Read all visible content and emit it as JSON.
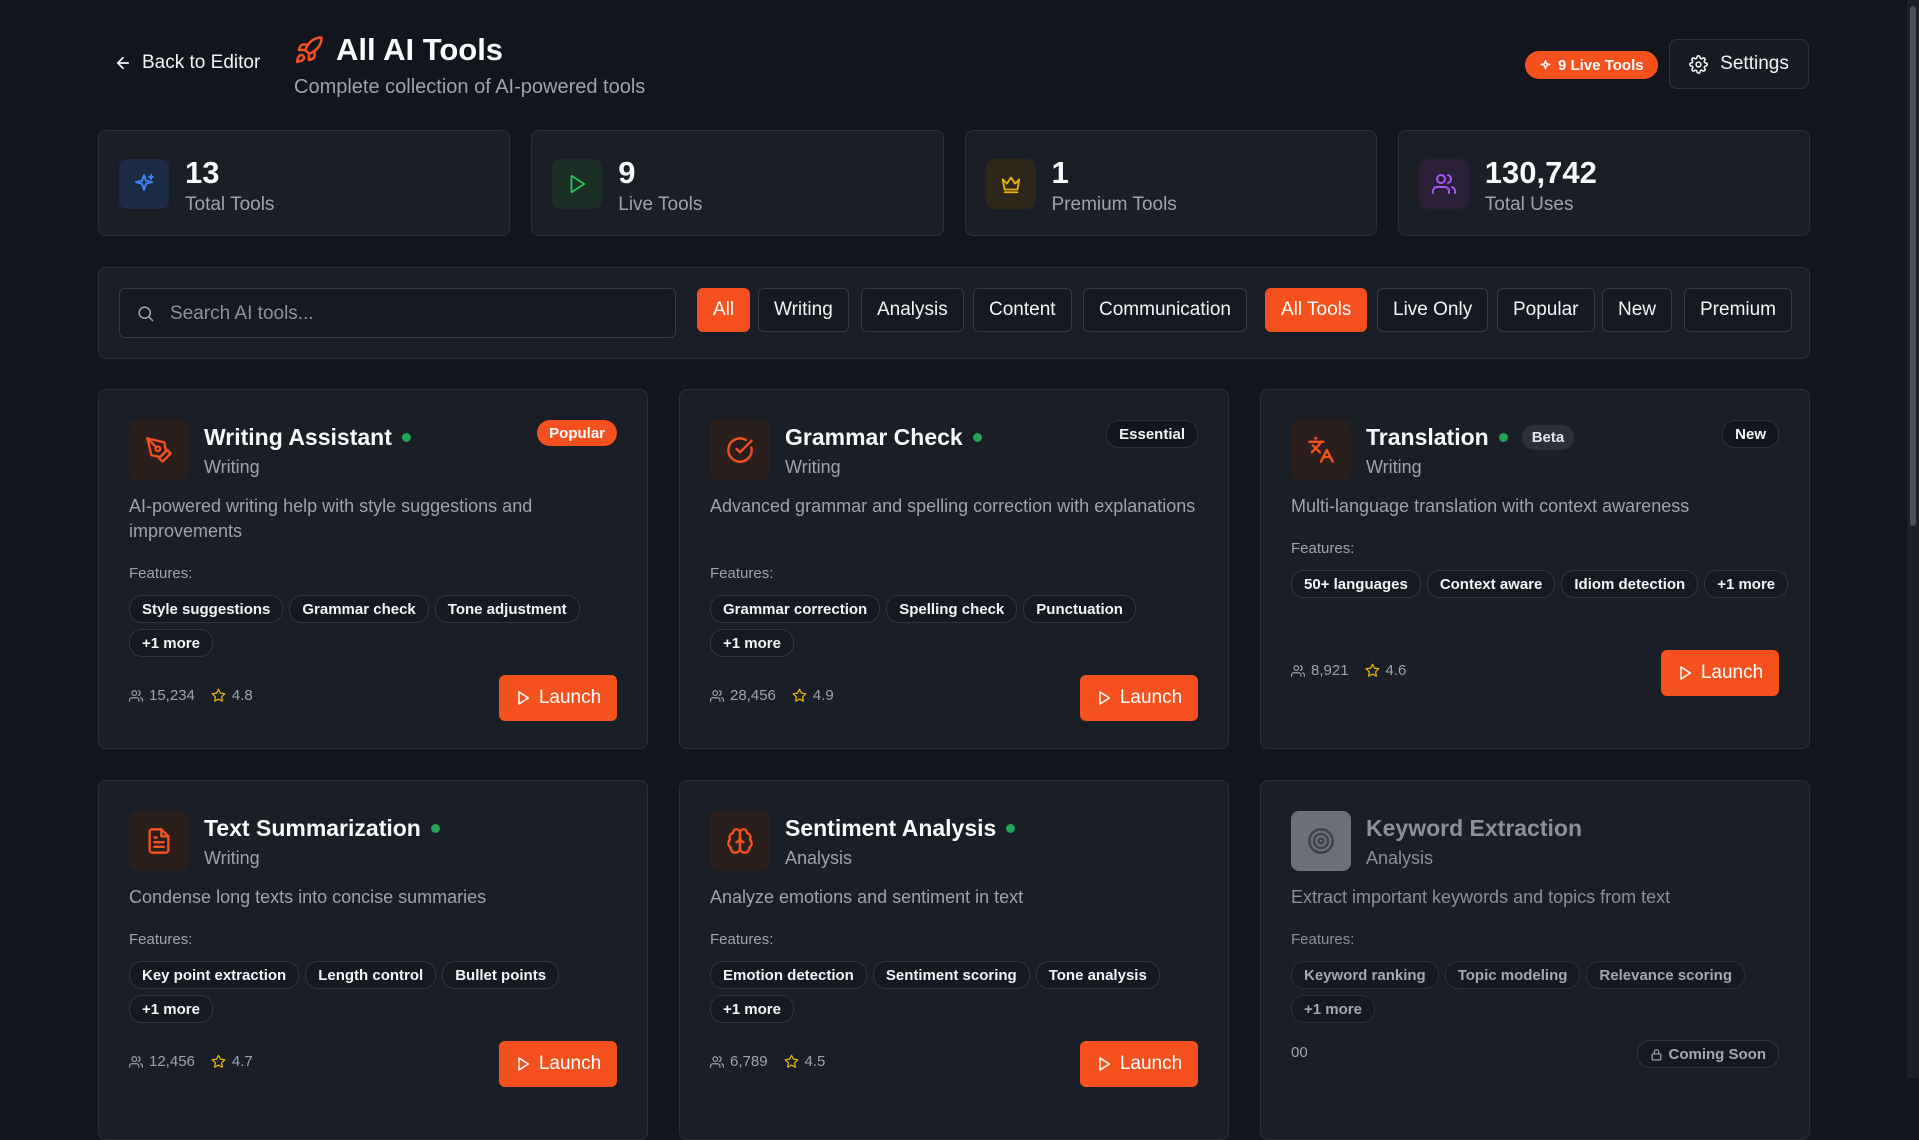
{
  "header": {
    "back_label": "Back to Editor",
    "title": "All AI Tools",
    "subtitle": "Complete collection of AI-powered tools",
    "live_badge": "9 Live Tools",
    "settings_label": "Settings"
  },
  "stats": [
    {
      "value": "13",
      "label": "Total Tools",
      "icon": "sparkles-icon"
    },
    {
      "value": "9",
      "label": "Live Tools",
      "icon": "play-icon"
    },
    {
      "value": "1",
      "label": "Premium Tools",
      "icon": "crown-icon"
    },
    {
      "value": "130,742",
      "label": "Total Uses",
      "icon": "users-icon"
    }
  ],
  "search": {
    "placeholder": "Search AI tools..."
  },
  "category_filters": [
    "All",
    "Writing",
    "Analysis",
    "Content",
    "Communication"
  ],
  "status_filters": [
    "All Tools",
    "Live Only",
    "Popular",
    "New",
    "Premium"
  ],
  "features_label": "Features:",
  "launch_label": "Launch",
  "tools": [
    {
      "name": "Writing Assistant",
      "category": "Writing",
      "badge": "Popular",
      "description": "AI-powered writing help with style suggestions and improvements",
      "features": [
        "Style suggestions",
        "Grammar check",
        "Tone adjustment",
        "+1 more"
      ],
      "users": "15,234",
      "rating": "4.8"
    },
    {
      "name": "Grammar Check",
      "category": "Writing",
      "badge": "Essential",
      "description": "Advanced grammar and spelling correction with explanations",
      "features": [
        "Grammar correction",
        "Spelling check",
        "Punctuation",
        "+1 more"
      ],
      "users": "28,456",
      "rating": "4.9"
    },
    {
      "name": "Translation",
      "category": "Writing",
      "tag": "Beta",
      "badge": "New",
      "description": "Multi-language translation with context awareness",
      "features": [
        "50+ languages",
        "Context aware",
        "Idiom detection",
        "+1 more"
      ],
      "users": "8,921",
      "rating": "4.6"
    },
    {
      "name": "Text Summarization",
      "category": "Writing",
      "description": "Condense long texts into concise summaries",
      "features": [
        "Key point extraction",
        "Length control",
        "Bullet points",
        "+1 more"
      ],
      "users": "12,456",
      "rating": "4.7"
    },
    {
      "name": "Sentiment Analysis",
      "category": "Analysis",
      "description": "Analyze emotions and sentiment in text",
      "features": [
        "Emotion detection",
        "Sentiment scoring",
        "Tone analysis",
        "+1 more"
      ],
      "users": "6,789",
      "rating": "4.5"
    },
    {
      "name": "Keyword Extraction",
      "category": "Analysis",
      "description": "Extract important keywords and topics from text",
      "features": [
        "Keyword ranking",
        "Topic modeling",
        "Relevance scoring",
        "+1 more"
      ],
      "users": "00",
      "status": "Coming Soon"
    }
  ],
  "colors": {
    "accent": "#f4511e",
    "live_dot": "#22a355",
    "background": "#12151d",
    "card": "#1a1e27"
  }
}
